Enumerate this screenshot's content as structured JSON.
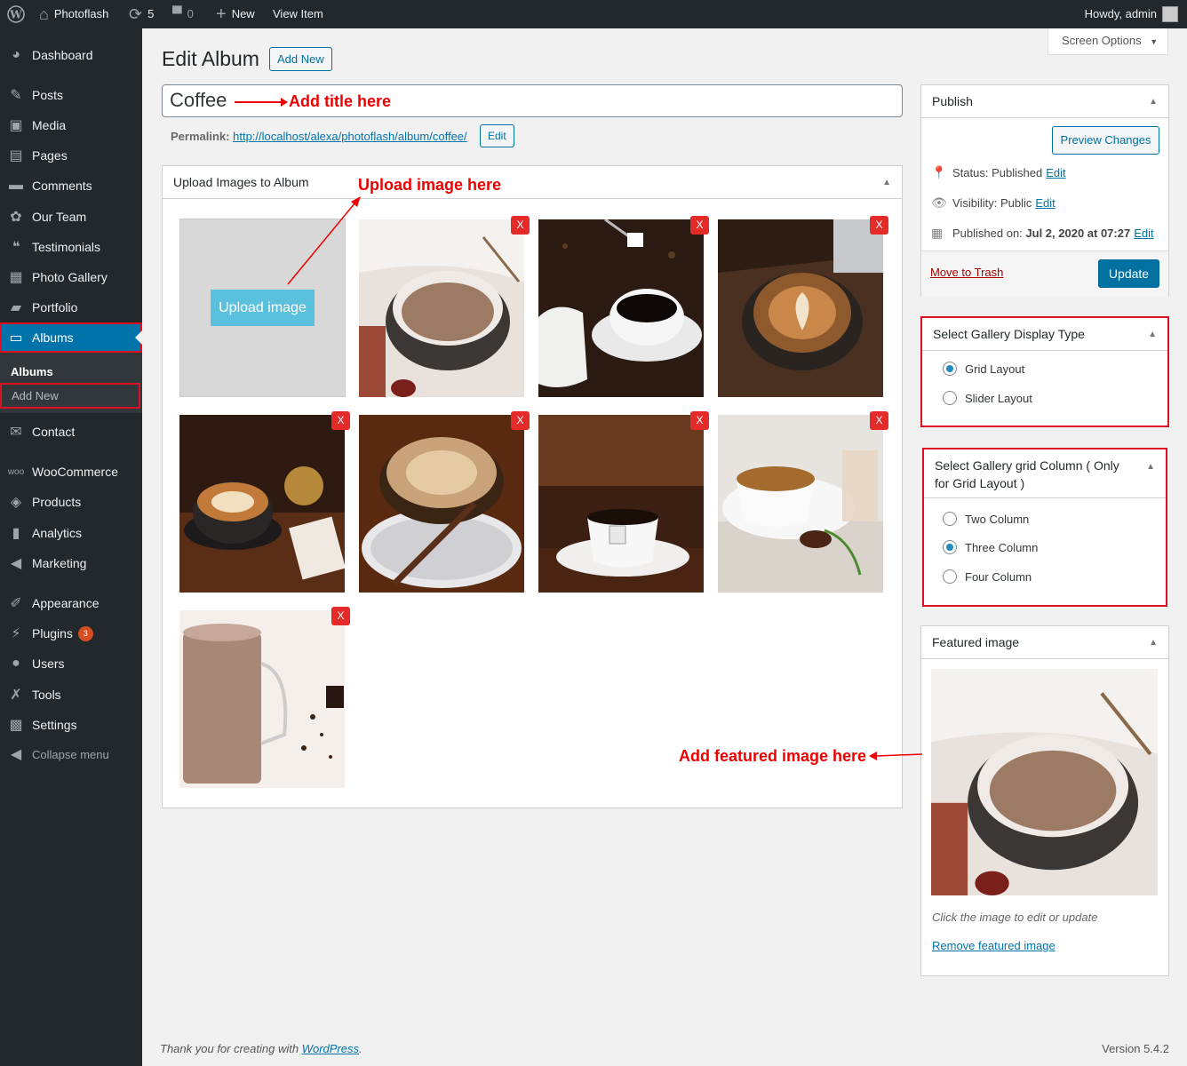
{
  "adminbar": {
    "site_name": "Photoflash",
    "updates_count": "5",
    "comments_count": "0",
    "new_label": "New",
    "view_item_label": "View Item",
    "howdy": "Howdy, admin"
  },
  "sidebar": {
    "items": [
      {
        "label": "Dashboard",
        "icon": "dashboard-icon"
      },
      {
        "label": "Posts",
        "icon": "pin-icon"
      },
      {
        "label": "Media",
        "icon": "media-icon"
      },
      {
        "label": "Pages",
        "icon": "pages-icon"
      },
      {
        "label": "Comments",
        "icon": "comment-icon"
      },
      {
        "label": "Our Team",
        "icon": "team-icon"
      },
      {
        "label": "Testimonials",
        "icon": "quote-icon"
      },
      {
        "label": "Photo Gallery",
        "icon": "gallery-icon"
      },
      {
        "label": "Portfolio",
        "icon": "portfolio-icon"
      },
      {
        "label": "Albums",
        "icon": "album-icon"
      },
      {
        "label": "Contact",
        "icon": "email-icon"
      },
      {
        "label": "WooCommerce",
        "icon": "woo-icon"
      },
      {
        "label": "Products",
        "icon": "products-icon"
      },
      {
        "label": "Analytics",
        "icon": "analytics-icon"
      },
      {
        "label": "Marketing",
        "icon": "marketing-icon"
      },
      {
        "label": "Appearance",
        "icon": "appearance-icon"
      },
      {
        "label": "Plugins",
        "icon": "plugins-icon",
        "badge": "3"
      },
      {
        "label": "Users",
        "icon": "users-icon"
      },
      {
        "label": "Tools",
        "icon": "tools-icon"
      },
      {
        "label": "Settings",
        "icon": "settings-icon"
      }
    ],
    "submenu_title": "Albums",
    "submenu_add_new": "Add New",
    "collapse": "Collapse menu"
  },
  "screen_options": "Screen Options",
  "header": {
    "title": "Edit Album",
    "add_new": "Add New"
  },
  "post": {
    "title_value": "Coffee",
    "permalink_label": "Permalink:",
    "permalink_url": "http://localhost/alexa/photoflash/album/coffee/",
    "permalink_edit": "Edit"
  },
  "upload_box": {
    "title": "Upload Images to Album",
    "upload_button": "Upload image",
    "delete_label": "X"
  },
  "annotations": {
    "title": "Add title here",
    "upload": "Upload image here",
    "featured": "Add featured image here"
  },
  "publish": {
    "title": "Publish",
    "preview": "Preview Changes",
    "status_label": "Status:",
    "status_value": "Published",
    "visibility_label": "Visibility:",
    "visibility_value": "Public",
    "published_label": "Published on:",
    "published_value": "Jul 2, 2020 at 07:27",
    "edit": "Edit",
    "trash": "Move to Trash",
    "update": "Update"
  },
  "display_type": {
    "title": "Select Gallery Display Type",
    "options": [
      "Grid Layout",
      "Slider Layout"
    ],
    "selected": "Grid Layout"
  },
  "grid_column": {
    "title_line1": "Select Gallery grid Column ( Only",
    "title_line2": "for Grid Layout )",
    "options": [
      "Two Column",
      "Three Column",
      "Four Column"
    ],
    "selected": "Three Column"
  },
  "featured": {
    "title": "Featured image",
    "hint": "Click the image to edit or update",
    "remove": "Remove featured image"
  },
  "footer": {
    "thanks_prefix": "Thank you for creating with ",
    "thanks_link": "WordPress",
    "thanks_suffix": ".",
    "version": "Version 5.4.2"
  },
  "colors": {
    "admin_dark": "#23282d",
    "accent": "#0073aa",
    "annotation_red": "#e00000",
    "delete_red": "#e52a2a"
  }
}
